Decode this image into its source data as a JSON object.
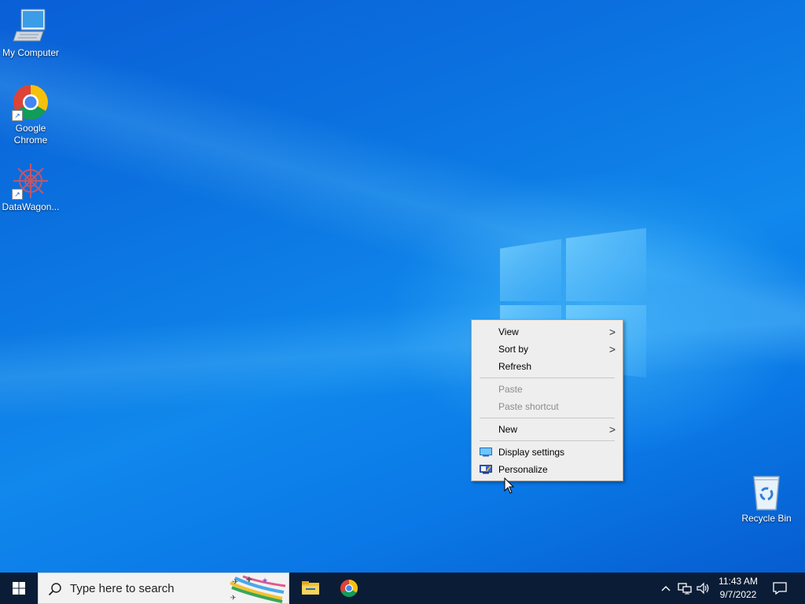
{
  "desktop": {
    "icons": [
      {
        "label": "My Computer"
      },
      {
        "label": "Google Chrome"
      },
      {
        "label": "DataWagon..."
      },
      {
        "label": "Recycle Bin"
      }
    ],
    "background_color": "#0a78e6"
  },
  "context_menu": {
    "items": [
      {
        "label": "View",
        "has_submenu": true,
        "enabled": true
      },
      {
        "label": "Sort by",
        "has_submenu": true,
        "enabled": true
      },
      {
        "label": "Refresh",
        "has_submenu": false,
        "enabled": true
      },
      {
        "label": "Paste",
        "has_submenu": false,
        "enabled": false
      },
      {
        "label": "Paste shortcut",
        "has_submenu": false,
        "enabled": false
      },
      {
        "label": "New",
        "has_submenu": true,
        "enabled": true
      },
      {
        "label": "Display settings",
        "icon": "display-icon",
        "enabled": true
      },
      {
        "label": "Personalize",
        "icon": "personalize-icon",
        "enabled": true
      }
    ],
    "submenu_glyph": ">"
  },
  "taskbar": {
    "search_placeholder": "Type here to search",
    "pinned_apps": [
      {
        "name": "File Explorer",
        "icon": "folder-icon"
      },
      {
        "name": "Google Chrome",
        "icon": "chrome-icon"
      }
    ],
    "tray_icons": [
      "chevron-up-icon",
      "network-icon",
      "volume-icon"
    ],
    "clock": {
      "time": "11:43 AM",
      "date": "9/7/2022"
    },
    "action_center_icon": "notification-icon"
  }
}
